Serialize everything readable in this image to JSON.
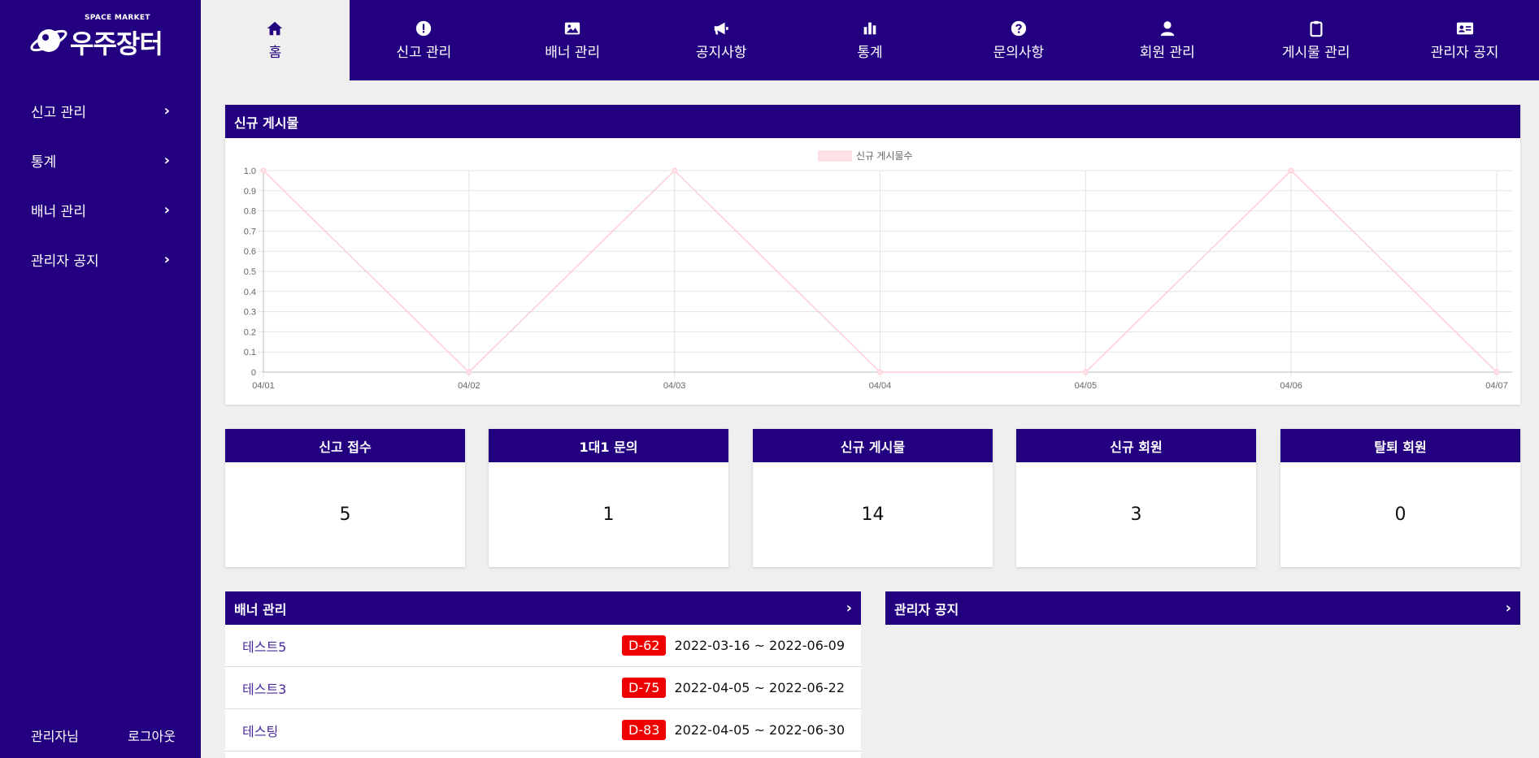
{
  "logo": {
    "small": "SPACE MARKET",
    "big": "우주장터"
  },
  "sidebar": {
    "items": [
      {
        "label": "신고 관리"
      },
      {
        "label": "통계"
      },
      {
        "label": "배너 관리"
      },
      {
        "label": "관리자 공지"
      }
    ],
    "chevron": "›",
    "user": "관리자님",
    "logout": "로그아웃"
  },
  "nav": {
    "items": [
      {
        "label": "홈",
        "icon": "home-icon",
        "active": true
      },
      {
        "label": "신고 관리",
        "icon": "exclamation-icon"
      },
      {
        "label": "배너 관리",
        "icon": "image-icon"
      },
      {
        "label": "공지사항",
        "icon": "megaphone-icon"
      },
      {
        "label": "통계",
        "icon": "bar-chart-icon"
      },
      {
        "label": "문의사항",
        "icon": "question-icon"
      },
      {
        "label": "회원 관리",
        "icon": "user-icon"
      },
      {
        "label": "게시물 관리",
        "icon": "clipboard-icon"
      },
      {
        "label": "관리자 공지",
        "icon": "id-card-icon"
      }
    ]
  },
  "chart_panel": {
    "title": "신규 게시물"
  },
  "chart_data": {
    "type": "line",
    "categories": [
      "04/01",
      "04/02",
      "04/03",
      "04/04",
      "04/05",
      "04/06",
      "04/07"
    ],
    "series": [
      {
        "name": "신규 게시물수",
        "values": [
          1,
          0,
          1,
          0,
          0,
          1,
          0
        ]
      }
    ],
    "ylim": [
      0,
      1
    ],
    "yticks": [
      "0",
      "0.1",
      "0.2",
      "0.3",
      "0.4",
      "0.5",
      "0.6",
      "0.7",
      "0.8",
      "0.9",
      "1.0"
    ],
    "grid": true,
    "legend": "top-center",
    "color": "#ffccd5"
  },
  "stats": [
    {
      "title": "신고 접수",
      "value": "5"
    },
    {
      "title": "1대1 문의",
      "value": "1"
    },
    {
      "title": "신규 게시물",
      "value": "14"
    },
    {
      "title": "신규 회원",
      "value": "3"
    },
    {
      "title": "탈퇴 회원",
      "value": "0"
    }
  ],
  "banner_panel": {
    "title": "배너 관리",
    "rows": [
      {
        "name": "테스트5",
        "dday": "D-62",
        "range": "2022-03-16 ~ 2022-06-09"
      },
      {
        "name": "테스트3",
        "dday": "D-75",
        "range": "2022-04-05 ~ 2022-06-22"
      },
      {
        "name": "테스팅",
        "dday": "D-83",
        "range": "2022-04-05 ~ 2022-06-30"
      }
    ]
  },
  "notice_panel": {
    "title": "관리자 공지"
  },
  "colors": {
    "primary": "#22007f",
    "badge": "#ee0000",
    "background": "#efefef"
  }
}
